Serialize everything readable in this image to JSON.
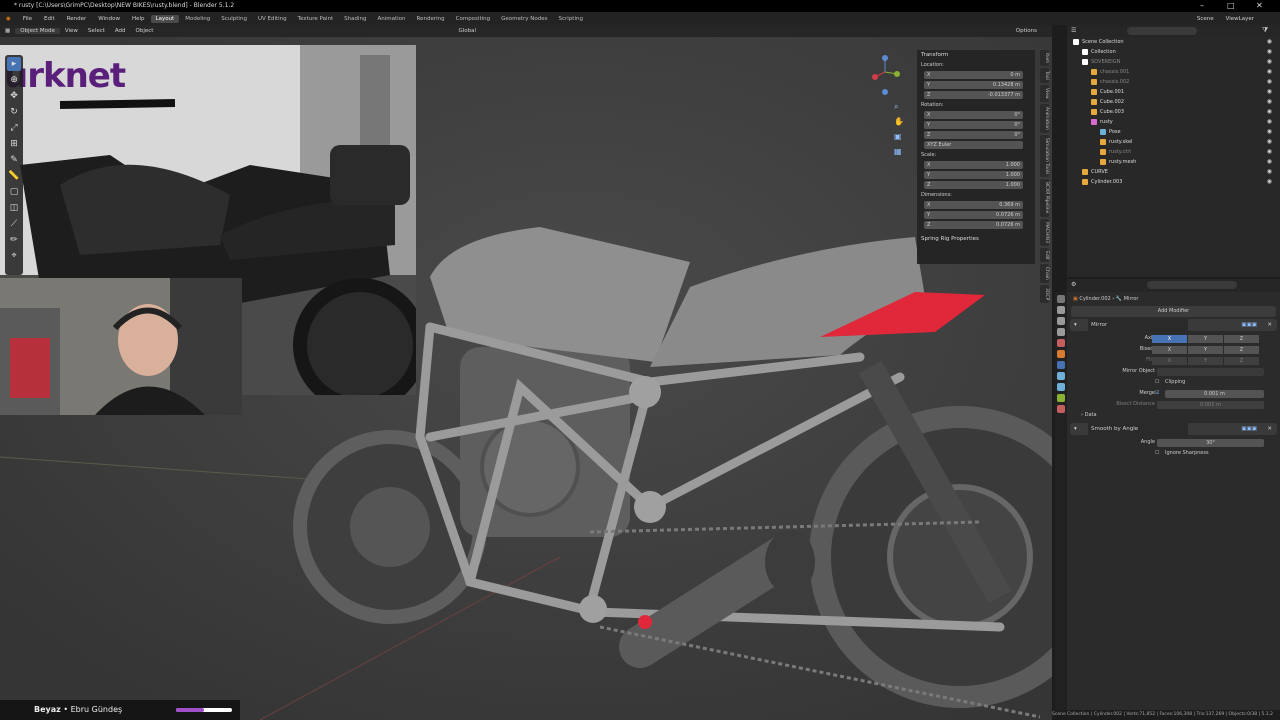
{
  "window": {
    "title": "* rusty [C:\\Users\\GrimPC\\Desktop\\NEW BIKES\\rusty.blend] - Blender 5.1.2"
  },
  "menu": {
    "items": [
      "File",
      "Edit",
      "Render",
      "Window",
      "Help"
    ]
  },
  "workspaces": [
    "Layout",
    "Modeling",
    "Sculpting",
    "UV Editing",
    "Texture Paint",
    "Shading",
    "Animation",
    "Rendering",
    "Compositing",
    "Geometry Nodes",
    "Scripting"
  ],
  "topbar_right": {
    "scene": "Scene",
    "viewlayer": "ViewLayer"
  },
  "viewport_header": {
    "mode": "Object Mode",
    "view": "View",
    "select": "Select",
    "add": "Add",
    "object": "Object",
    "orientation": "Global",
    "options": "Options"
  },
  "overlay": {
    "brand": "urknet"
  },
  "npanel": {
    "transform_title": "Transform",
    "location_label": "Location:",
    "location": [
      {
        "axis": "X",
        "value": "0 m"
      },
      {
        "axis": "Y",
        "value": "0.13428 m"
      },
      {
        "axis": "Z",
        "value": "-0.013377 m"
      }
    ],
    "rotation_label": "Rotation:",
    "rotation": [
      {
        "axis": "X",
        "value": "0°"
      },
      {
        "axis": "Y",
        "value": "0°"
      },
      {
        "axis": "Z",
        "value": "0°"
      }
    ],
    "rotation_mode": "XYZ Euler",
    "scale_label": "Scale:",
    "scale": [
      {
        "axis": "X",
        "value": "1.000"
      },
      {
        "axis": "Y",
        "value": "1.000"
      },
      {
        "axis": "Z",
        "value": "1.000"
      }
    ],
    "dimensions_label": "Dimensions:",
    "dimensions": [
      {
        "axis": "X",
        "value": "0.369 m"
      },
      {
        "axis": "Y",
        "value": "0.0726 m"
      },
      {
        "axis": "Z",
        "value": "0.0726 m"
      }
    ],
    "spring_rig": "Spring Rig Properties"
  },
  "sidebar_tabs": [
    "Item",
    "Tool",
    "View",
    "Animation",
    "Simulation Tools",
    "BCXR Pipeline",
    "MACHIN3",
    "Edit",
    "Chain",
    "3DCP"
  ],
  "outliner": {
    "rows": [
      {
        "label": "Scene Collection",
        "indent": 0,
        "dim": false,
        "sel": false,
        "color": "#ffffff"
      },
      {
        "label": "Collection",
        "indent": 1,
        "dim": false,
        "sel": false,
        "color": "#ffffff"
      },
      {
        "label": "SOVEREIGN",
        "indent": 1,
        "dim": true,
        "sel": false,
        "color": "#ffffff"
      },
      {
        "label": "chassis.001",
        "indent": 2,
        "dim": true,
        "sel": false,
        "color": "#e5a93d"
      },
      {
        "label": "chassis.002",
        "indent": 2,
        "dim": true,
        "sel": false,
        "color": "#e5a93d"
      },
      {
        "label": "Cube.001",
        "indent": 2,
        "dim": false,
        "sel": false,
        "color": "#e5a93d"
      },
      {
        "label": "Cube.002",
        "indent": 2,
        "dim": false,
        "sel": false,
        "color": "#e5a93d"
      },
      {
        "label": "Cube.003",
        "indent": 2,
        "dim": false,
        "sel": false,
        "color": "#e5a93d"
      },
      {
        "label": "rusty",
        "indent": 2,
        "dim": false,
        "sel": false,
        "color": "#d96ad1"
      },
      {
        "label": "Pose",
        "indent": 3,
        "dim": false,
        "sel": false,
        "color": "#6fb0d9"
      },
      {
        "label": "rusty.skel",
        "indent": 3,
        "dim": false,
        "sel": false,
        "color": "#e5a93d"
      },
      {
        "label": "rusty.ctrl",
        "indent": 3,
        "dim": true,
        "sel": false,
        "color": "#e5a93d"
      },
      {
        "label": "rusty.mesh",
        "indent": 3,
        "dim": false,
        "sel": false,
        "color": "#e5a93d"
      },
      {
        "label": "CURVE",
        "indent": 1,
        "dim": false,
        "sel": false,
        "color": "#e5a93d"
      },
      {
        "label": "Cylinder.003",
        "indent": 1,
        "dim": false,
        "sel": false,
        "color": "#e5a93d"
      }
    ]
  },
  "properties": {
    "breadcrumb_object": "Cylinder.002",
    "breadcrumb_modifier": "Mirror",
    "add_modifier": "Add Modifier",
    "mirror": {
      "name": "Mirror",
      "axis_label": "Axis",
      "bisect_label": "Bisect",
      "flip_label": "Flip",
      "x": "X",
      "y": "Y",
      "z": "Z",
      "mirror_object_label": "Mirror Object",
      "clipping_label": "Clipping",
      "merge_label": "Merge",
      "merge_value": "0.001 m",
      "bisect_distance_label": "Bisect Distance",
      "bisect_distance_value": "0.001 m",
      "data_label": "Data"
    },
    "smooth": {
      "name": "Smooth by Angle",
      "angle_label": "Angle",
      "angle_value": "30°",
      "ignore_label": "Ignore Sharpness"
    }
  },
  "status": {
    "text": "Scene Collection | Cylinder.002 | Verts:71,852 | Faces:106,308 | Tris:137,269 | Objects:0/38 | 5.1.2"
  },
  "music": {
    "title": "Beyaz",
    "artist": "Ebru Gündeş",
    "progress": 0.5
  },
  "colors": {
    "accent": "#4772b3",
    "brand": "#5a1f7a",
    "seat_red": "#e0283a",
    "music_bar": "#a04ec9"
  }
}
